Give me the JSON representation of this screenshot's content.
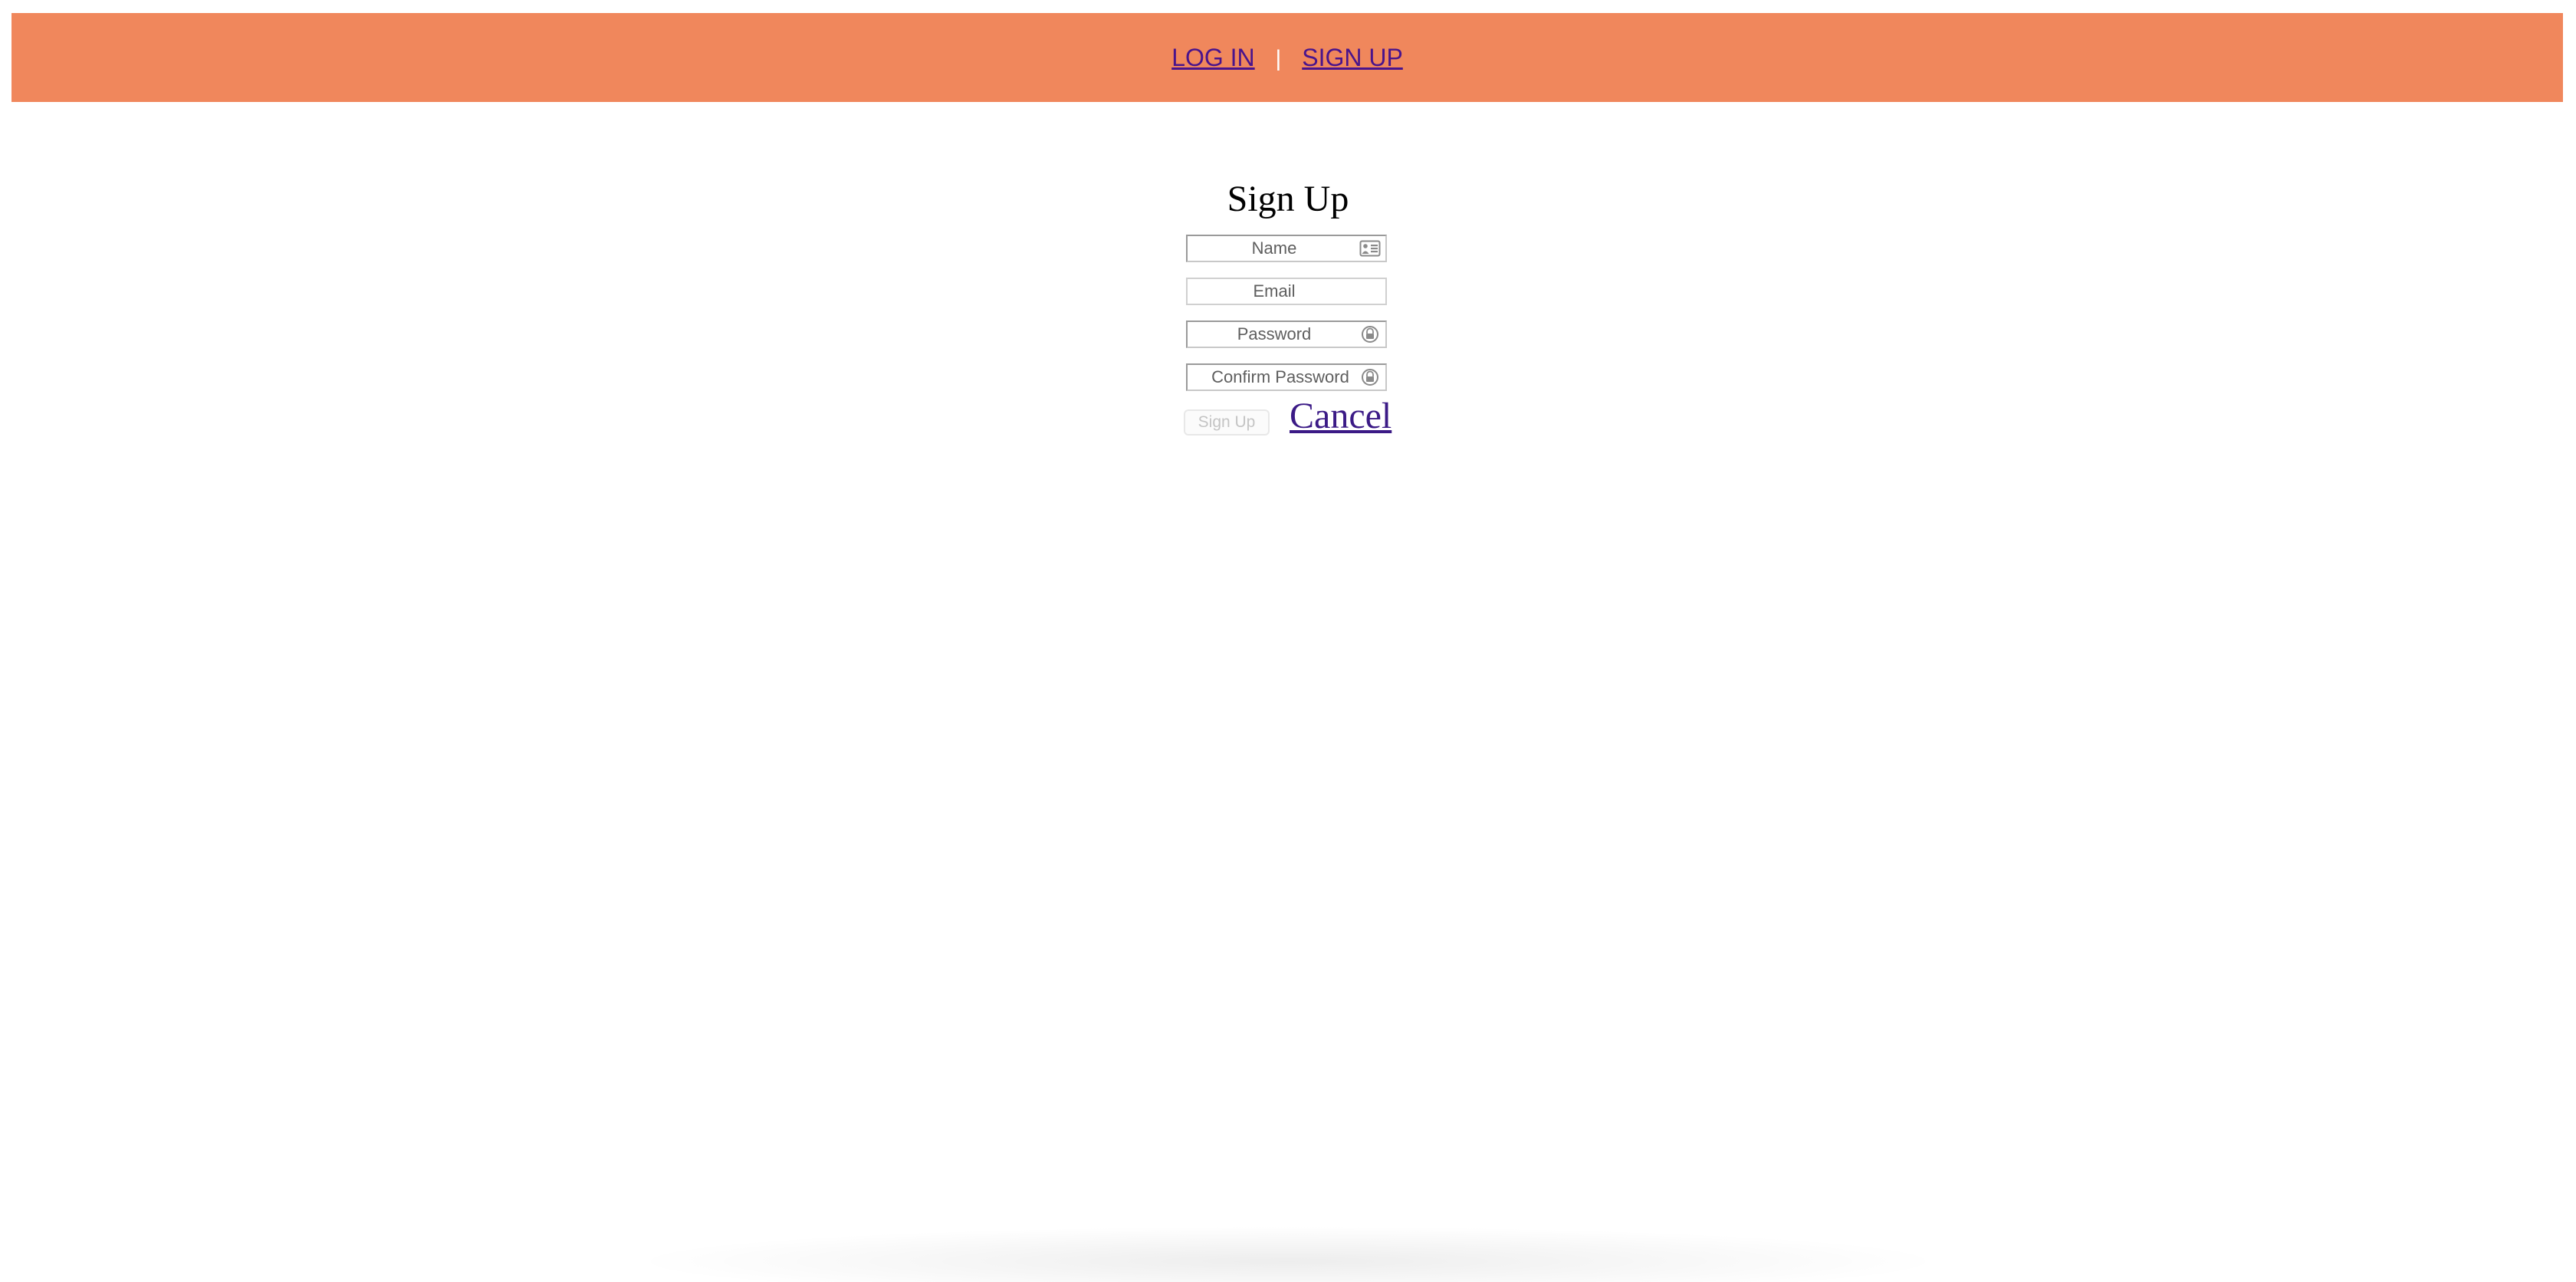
{
  "nav": {
    "login_label": "LOG IN",
    "separator": "|",
    "signup_label": "SIGN UP"
  },
  "form": {
    "title": "Sign Up",
    "fields": {
      "name": {
        "placeholder": "Name",
        "value": "",
        "icon": "contact-card-icon"
      },
      "email": {
        "placeholder": "Email",
        "value": ""
      },
      "password": {
        "placeholder": "Password",
        "value": "",
        "icon": "password-key-icon"
      },
      "confirm_password": {
        "placeholder": "Confirm Password",
        "value": "",
        "icon": "password-key-icon"
      }
    },
    "submit_label": "Sign Up",
    "cancel_label": "Cancel"
  },
  "colors": {
    "header_bg": "#f0875c",
    "link": "#4a148c",
    "disabled_text": "#c4c4c4"
  }
}
